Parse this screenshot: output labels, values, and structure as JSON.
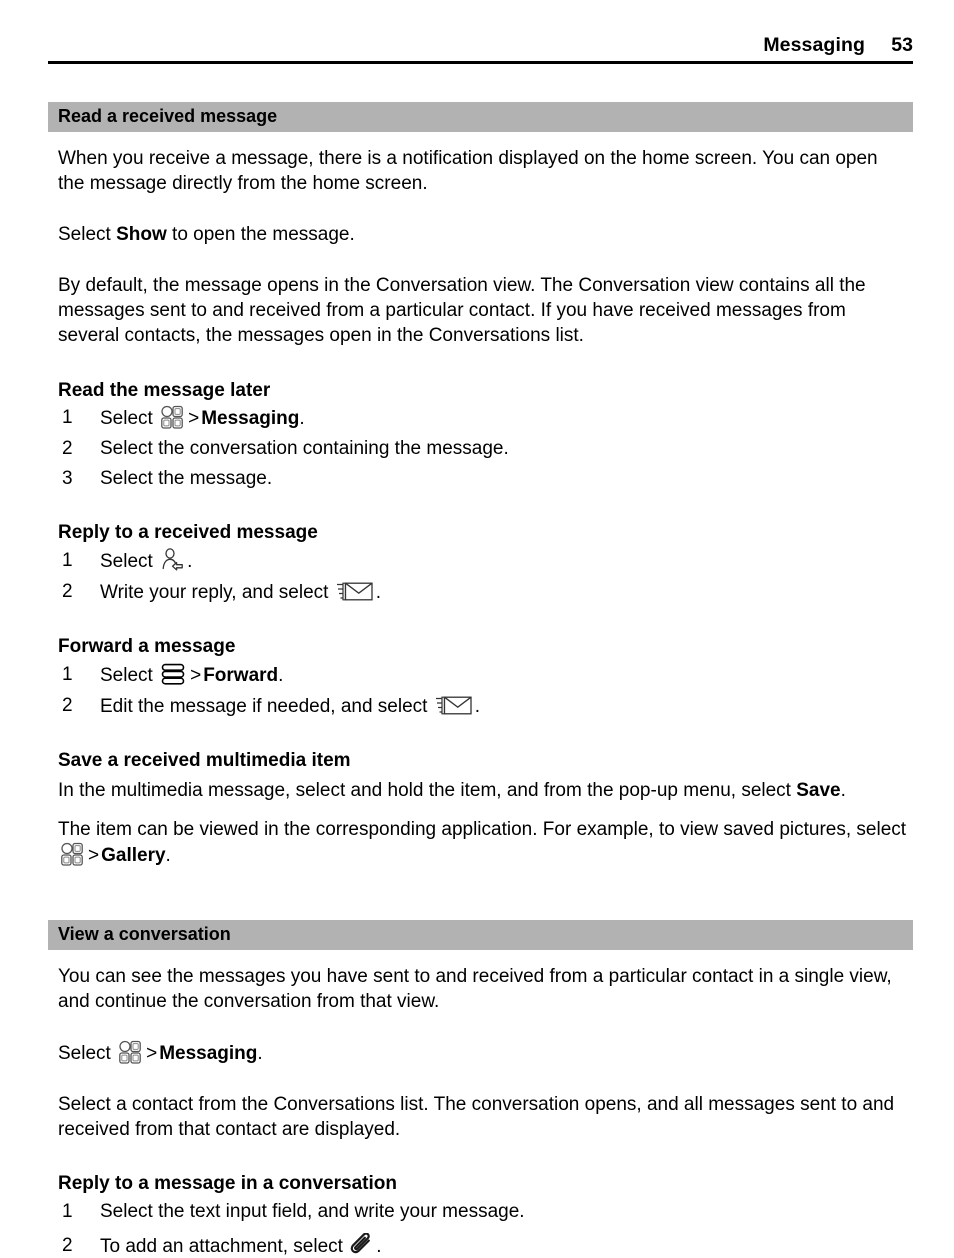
{
  "header": {
    "title": "Messaging",
    "page_number": "53"
  },
  "colors": {
    "band_background": "#b2b2b2",
    "text": "#000000",
    "page_background": "#ffffff"
  },
  "sections": [
    {
      "band_title": "Read a received message",
      "intro_paragraph": "When you receive a message, there is a notification displayed on the home screen. You can open the message directly from the home screen.",
      "select_show": {
        "prefix": "Select ",
        "bold": "Show",
        "suffix": " to open the message."
      },
      "conversation_paragraph": "By default, the message opens in the Conversation view. The Conversation view contains all the messages sent to and received from a particular contact. If you have received messages from several contacts, the messages open in the Conversations list.",
      "sub_read_later": {
        "title": "Read the message later",
        "steps": [
          {
            "num": "1",
            "prefix": "Select ",
            "icon": "menu-grid-icon",
            "separator": ">",
            "bold": "Messaging",
            "suffix": "."
          },
          {
            "num": "2",
            "text": "Select the conversation containing the message."
          },
          {
            "num": "3",
            "text": "Select the message."
          }
        ]
      },
      "sub_reply": {
        "title": "Reply to a received message",
        "steps": [
          {
            "num": "1",
            "prefix": "Select ",
            "icon": "reply-contact-icon",
            "suffix": "."
          },
          {
            "num": "2",
            "prefix": "Write your reply, and select ",
            "icon": "send-envelope-icon",
            "suffix": "."
          }
        ]
      },
      "sub_forward": {
        "title": "Forward a message",
        "steps": [
          {
            "num": "1",
            "prefix": "Select ",
            "icon": "options-list-icon",
            "separator": ">",
            "bold": "Forward",
            "suffix": "."
          },
          {
            "num": "2",
            "prefix": "Edit the message if needed, and select ",
            "icon": "send-envelope-icon",
            "suffix": "."
          }
        ]
      },
      "sub_save": {
        "title": "Save a received multimedia item",
        "paragraph_1": {
          "prefix": "In the multimedia message, select and hold the item, and from the pop-up menu, select ",
          "bold": "Save",
          "suffix": "."
        },
        "paragraph_2": {
          "prefix": "The item can be viewed in the corresponding application. For example, to view saved pictures, select ",
          "icon": "menu-grid-icon",
          "separator": ">",
          "bold": "Gallery",
          "suffix": "."
        }
      }
    },
    {
      "band_title": "View a conversation",
      "intro_paragraph": "You can see the messages you have sent to and received from a particular contact in a single view, and continue the conversation from that view.",
      "select_messaging": {
        "prefix": "Select ",
        "icon": "menu-grid-icon",
        "separator": ">",
        "bold": "Messaging",
        "suffix": "."
      },
      "contact_paragraph": "Select a contact from the Conversations list. The conversation opens, and all messages sent to and received from that contact are displayed.",
      "sub_reply_conversation": {
        "title": "Reply to a message in a conversation",
        "steps": [
          {
            "num": "1",
            "text": "Select the text input field, and write your message."
          },
          {
            "num": "2",
            "prefix": "To add an attachment, select ",
            "icon": "attachment-clip-icon",
            "suffix": "."
          }
        ]
      }
    }
  ]
}
